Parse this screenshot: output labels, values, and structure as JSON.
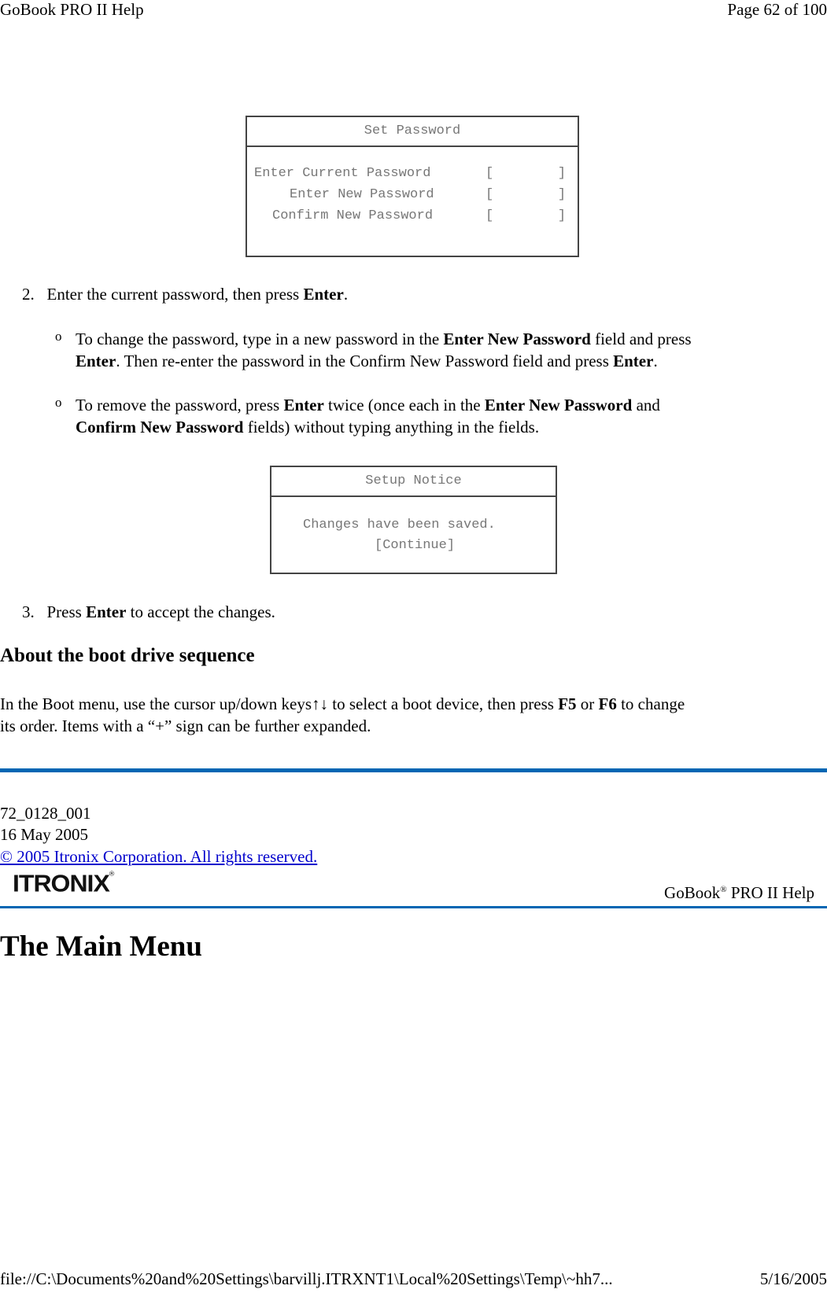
{
  "header": {
    "title": "GoBook PRO II Help",
    "page": "Page 62 of 100"
  },
  "set_password_dialog": {
    "title": "Set Password",
    "rows": [
      {
        "label": "Enter Current Password",
        "field": "[        ]"
      },
      {
        "label": "Enter New Password",
        "field": "[        ]"
      },
      {
        "label": "Confirm New Password",
        "field": "[        ]"
      }
    ]
  },
  "step2": {
    "num": "2.",
    "pre": "Enter the current password, then press ",
    "bold": "Enter",
    "post": "."
  },
  "bullet1": {
    "t1": "To change the password, type in a new password in the ",
    "b1": "Enter New Password",
    "t2": " field and press",
    "b2": "Enter",
    "t3": ". Then re-enter the password in the Confirm New Password field and press ",
    "b3": "Enter",
    "t4": "."
  },
  "bullet2": {
    "t1": "To remove the password, press ",
    "b1": "Enter",
    "t2": " twice (once each in the ",
    "b2": "Enter New Password",
    "t3": " and",
    "b3": "Confirm New Password",
    "t4": " fields) without typing anything in the fields."
  },
  "setup_notice_dialog": {
    "title": "Setup Notice",
    "message": "Changes have been saved.",
    "button": "[Continue]"
  },
  "step3": {
    "num": "3.",
    "pre": "Press ",
    "bold": "Enter",
    "post": " to accept the changes."
  },
  "boot_section": {
    "heading": "About the boot drive sequence",
    "t1": "In the Boot menu, use the cursor up/down keys",
    "arrows": "↑↓",
    "t2": " to select a boot device, then press ",
    "b1": "F5",
    "t3": " or ",
    "b2": "F6",
    "t4": " to change",
    "line2": "its order. Items with a “+” sign can be further expanded."
  },
  "footer": {
    "doc_id": " 72_0128_001",
    "date": "16 May 2005",
    "copyright": "© 2005 Itronix Corporation.  All rights reserved.",
    "logo": "ITRONIX",
    "logo_mark": "®",
    "product_pre": "GoBook",
    "product_mark": "®",
    "product_post": " PRO II Help"
  },
  "next_heading": "The Main Menu",
  "status": {
    "path": "file://C:\\Documents%20and%20Settings\\barvillj.ITRXNT1\\Local%20Settings\\Temp\\~hh7...",
    "date": "5/16/2005"
  },
  "colors": {
    "rule": "#0066b3",
    "link": "#0000cc"
  }
}
